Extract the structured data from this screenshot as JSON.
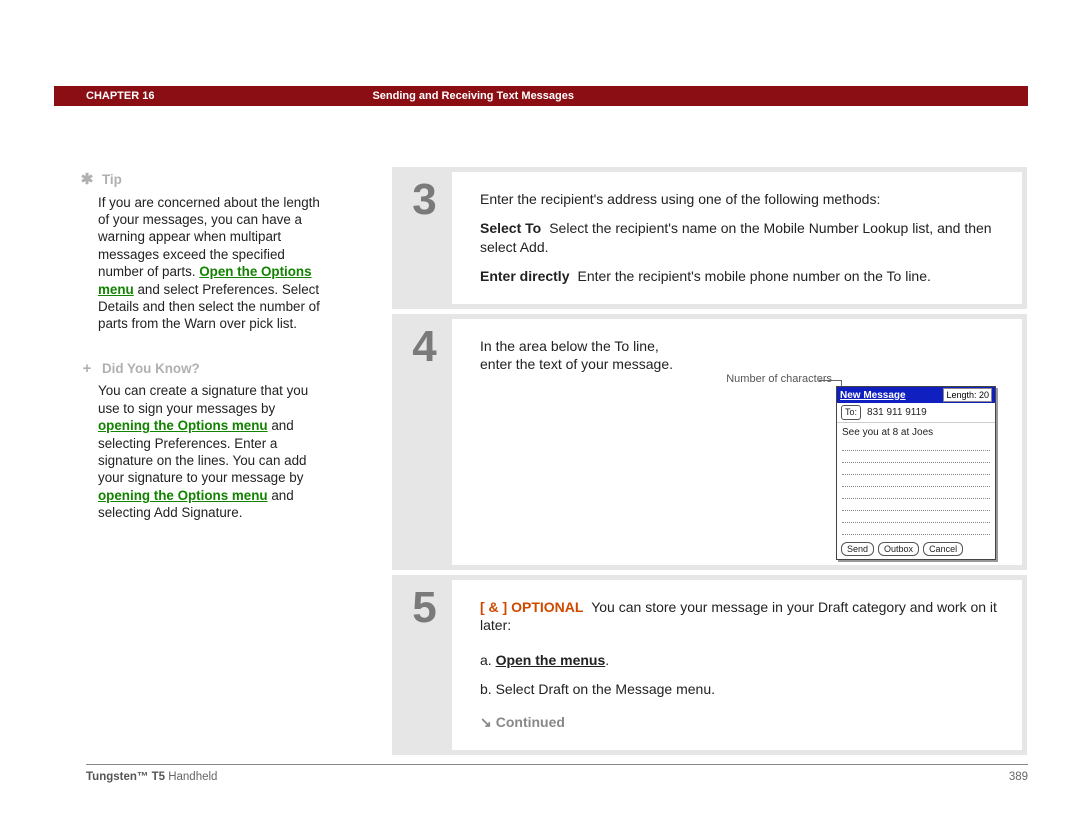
{
  "header": {
    "chapter": "CHAPTER 16",
    "title": "Sending and Receiving Text Messages"
  },
  "sidebar": {
    "tip_label": "Tip",
    "tip_pre": "If you are concerned about the length of your messages, you can have a warning appear when multipart messages exceed the specified number of parts. ",
    "tip_link": "Open the Options menu",
    "tip_post": " and select Preferences. Select Details and then select the number of parts from the Warn over pick list.",
    "dyk_label": "Did You Know?",
    "dyk_pre": "You can create a signature that you use to sign your messages by ",
    "dyk_link1": "opening the Options menu",
    "dyk_mid": " and selecting Preferences. Enter a signature on the lines. You can add your signature to your message by ",
    "dyk_link2": "opening the Options menu",
    "dyk_post": " and selecting Add Signature."
  },
  "steps": {
    "s3": {
      "num": "3",
      "intro": "Enter the recipient's address using one of the following methods:",
      "a_label": "Select To",
      "a_text": "Select the recipient's name on the Mobile Number Lookup list, and then select Add.",
      "b_label": "Enter directly",
      "b_text": "Enter the recipient's mobile phone number on the To line."
    },
    "s4": {
      "num": "4",
      "line1": "In the area below the To line,",
      "line2": "enter the text of your message.",
      "callout": "Number of characters",
      "mock": {
        "title": "New Message",
        "length": "Length: 20",
        "to_label": "To:",
        "to_value": "831 911 9119",
        "body": "See you at 8 at Joes",
        "btn1": "Send",
        "btn2": "Outbox",
        "btn3": "Cancel"
      }
    },
    "s5": {
      "num": "5",
      "tag": "[ & ]  OPTIONAL",
      "intro": "You can store your message in your Draft category and work on it later:",
      "a_pre": "a.  ",
      "a_link": "Open the menus",
      "a_post": ".",
      "b": "b.  Select Draft on the Message menu.",
      "cont": "Continued"
    }
  },
  "footer": {
    "bold": "Tungsten™ T5",
    "rest": " Handheld",
    "page": "389"
  }
}
